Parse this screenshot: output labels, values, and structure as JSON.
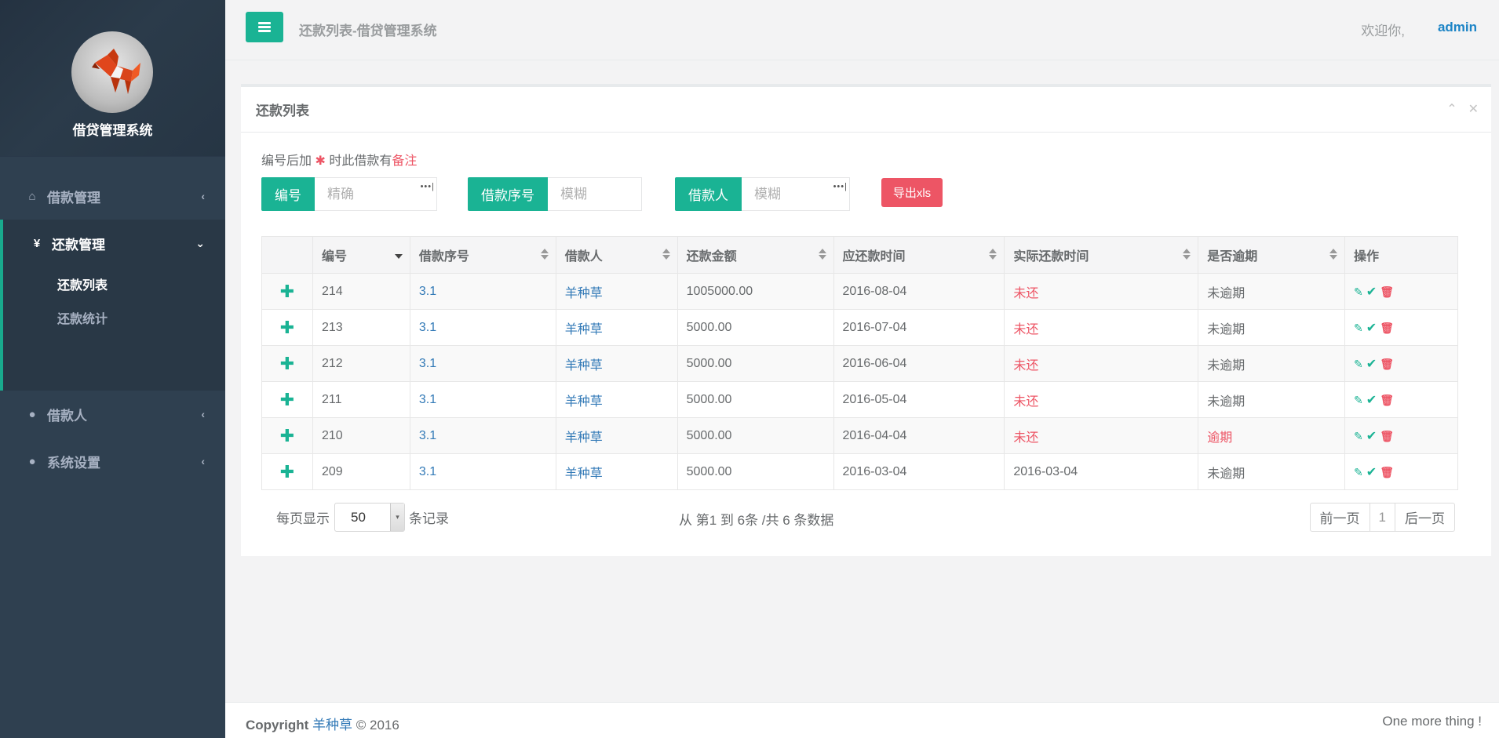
{
  "sidebar": {
    "system_name": "借贷管理系统",
    "nav": [
      {
        "label": "借款管理",
        "icon": "home-icon"
      },
      {
        "label": "还款管理",
        "icon": "yen-icon"
      },
      {
        "label": "借款人",
        "icon": "user-icon"
      },
      {
        "label": "系统设置",
        "icon": "user-icon"
      }
    ],
    "sub_items": [
      {
        "label": "还款列表"
      },
      {
        "label": "还款统计"
      }
    ],
    "icons": {
      "home": "⌂",
      "yen": "¥",
      "user": "●",
      "chevron_left": "‹",
      "chevron_down": "⌄"
    }
  },
  "topbar": {
    "breadcrumb": "还款列表-借贷管理系统",
    "welcome": "欢迎你,",
    "user": "admin"
  },
  "panel": {
    "title": "还款列表",
    "tool_collapse": "⌃",
    "tool_close": "✕",
    "note_prefix": "编号后加",
    "note_star": "✱",
    "note_mid": "时此借款有",
    "note_red": "备注",
    "filters": [
      {
        "label": "编号",
        "placeholder": "精确"
      },
      {
        "label": "借款序号",
        "placeholder": "模糊"
      },
      {
        "label": "借款人",
        "placeholder": "模糊"
      }
    ],
    "filter_dots": "•••|",
    "export_label": "导出xls"
  },
  "table": {
    "headers": [
      "",
      "编号",
      "借款序号",
      "借款人",
      "还款金额",
      "应还款时间",
      "实际还款时间",
      "是否逾期",
      "操作"
    ],
    "plus": "✚",
    "ops": {
      "edit": "✎",
      "ok": "✔",
      "del": "🗑"
    },
    "rows": [
      {
        "id": "214",
        "seq": "3.1",
        "borrower": "羊种草",
        "amount": "1005000.00",
        "due": "2016-08-04",
        "paid": "未还",
        "overdue": "未逾期"
      },
      {
        "id": "213",
        "seq": "3.1",
        "borrower": "羊种草",
        "amount": "5000.00",
        "due": "2016-07-04",
        "paid": "未还",
        "overdue": "未逾期"
      },
      {
        "id": "212",
        "seq": "3.1",
        "borrower": "羊种草",
        "amount": "5000.00",
        "due": "2016-06-04",
        "paid": "未还",
        "overdue": "未逾期"
      },
      {
        "id": "211",
        "seq": "3.1",
        "borrower": "羊种草",
        "amount": "5000.00",
        "due": "2016-05-04",
        "paid": "未还",
        "overdue": "未逾期"
      },
      {
        "id": "210",
        "seq": "3.1",
        "borrower": "羊种草",
        "amount": "5000.00",
        "due": "2016-04-04",
        "paid": "未还",
        "overdue": "逾期"
      },
      {
        "id": "209",
        "seq": "3.1",
        "borrower": "羊种草",
        "amount": "5000.00",
        "due": "2016-03-04",
        "paid": "2016-03-04",
        "overdue": "未逾期"
      }
    ]
  },
  "pagination": {
    "per_page_prefix": "每页显示",
    "per_page_value": "50",
    "per_page_suffix": "条记录",
    "select_arrow": "▾",
    "info": "从 第1 到 6条 /共 6 条数据",
    "prev": "前一页",
    "current": "1",
    "next": "后一页"
  },
  "footer": {
    "copyright": "Copyright",
    "author": "羊种草",
    "year": "© 2016",
    "right": "One more thing !"
  },
  "colors": {
    "sidebar": "#2f4050",
    "accent": "#1ab394",
    "danger": "#ed5565",
    "link": "#337ab7",
    "admin": "#1c84c6"
  }
}
